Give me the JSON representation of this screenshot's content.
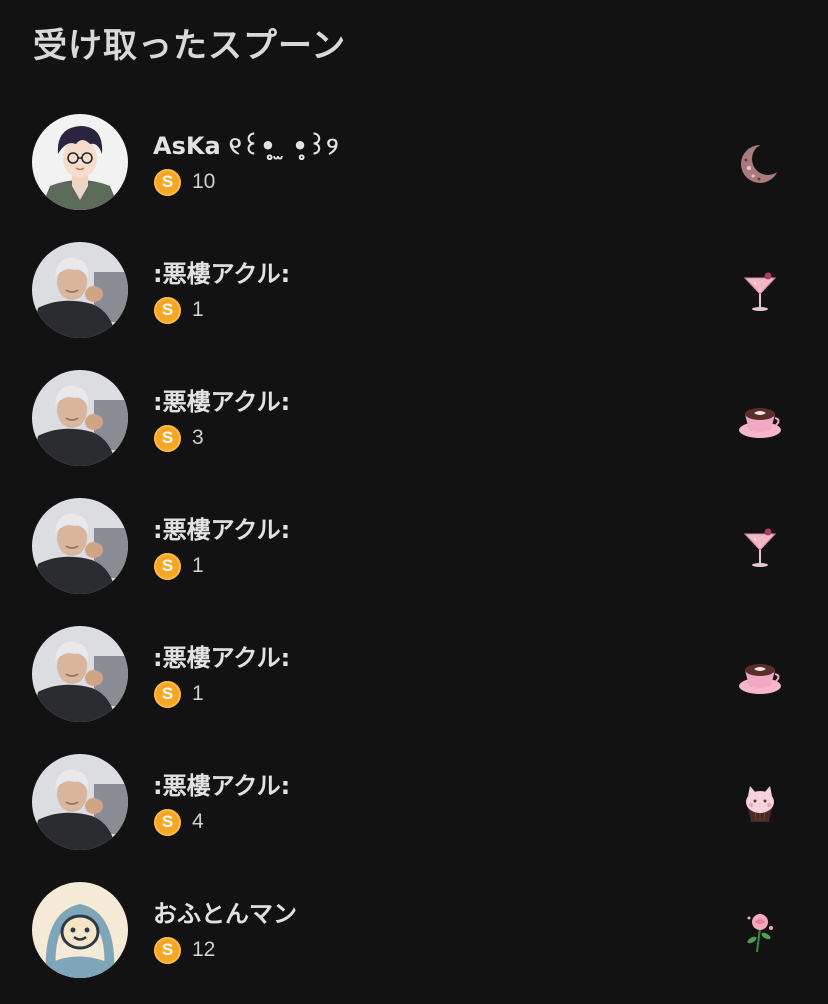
{
  "header": {
    "title": "受け取ったスプーン"
  },
  "colors": {
    "background": "#121212",
    "coin": "#f5a623",
    "text": "#e2e2e2"
  },
  "coin_label": "S",
  "items": [
    {
      "name": "AsKa ୧꒰•̥̥̥ ̫ •̥̥̥꒱୨",
      "count": "10",
      "avatar": "anime-boy-glasses",
      "gift": "crescent-moon"
    },
    {
      "name": ":悪樓アクル:",
      "count": "1",
      "avatar": "silver-haired-man",
      "gift": "cocktail-glass"
    },
    {
      "name": ":悪樓アクル:",
      "count": "3",
      "avatar": "silver-haired-man",
      "gift": "coffee-cup"
    },
    {
      "name": ":悪樓アクル:",
      "count": "1",
      "avatar": "silver-haired-man",
      "gift": "cocktail-glass"
    },
    {
      "name": ":悪樓アクル:",
      "count": "1",
      "avatar": "silver-haired-man",
      "gift": "coffee-cup"
    },
    {
      "name": ":悪樓アクル:",
      "count": "4",
      "avatar": "silver-haired-man",
      "gift": "cat-cupcake"
    },
    {
      "name": "おふとんマン",
      "count": "12",
      "avatar": "futon-man",
      "gift": "rose"
    }
  ]
}
